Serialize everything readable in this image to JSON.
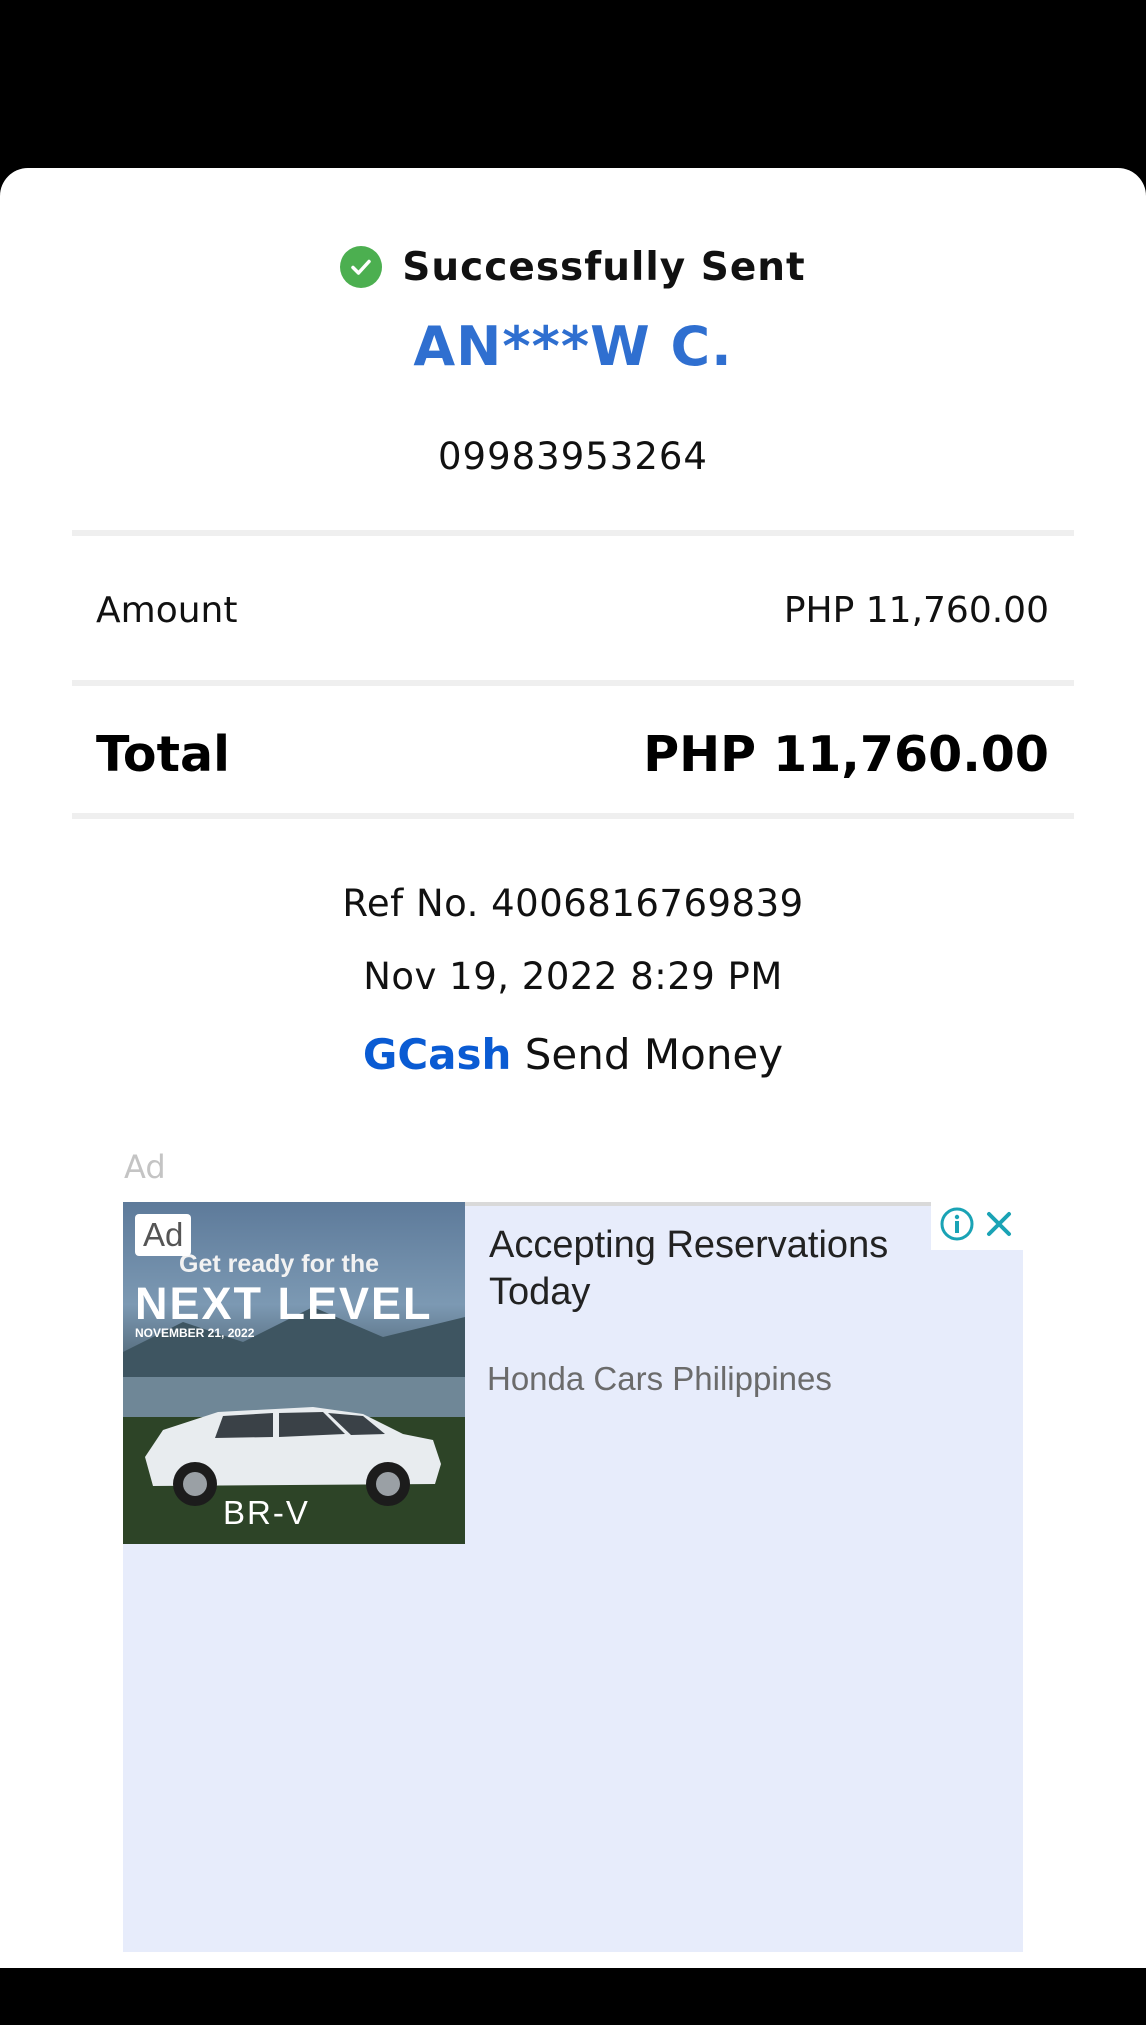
{
  "receipt": {
    "status": "Successfully Sent",
    "recipient_name": "AN***W C.",
    "recipient_number": "09983953264",
    "amount_label": "Amount",
    "amount_value": "PHP 11,760.00",
    "total_label": "Total",
    "total_value": "PHP 11,760.00",
    "ref_no": "Ref No. 4006816769839",
    "datetime": "Nov 19, 2022 8:29 PM",
    "service_brand": "GCash",
    "service_name": "Send Money"
  },
  "ad": {
    "section_label": "Ad",
    "badge": "Ad",
    "image_text_top": "Get ready for the",
    "image_text_main": "NEXT LEVEL",
    "image_text_date": "NOVEMBER 21, 2022",
    "image_text_model": "BR-V",
    "headline": "Accepting Reservations Today",
    "advertiser": "Honda Cars Philippines"
  },
  "colors": {
    "accent_blue": "#2f6fd0",
    "gcash_blue": "#0a5bd3",
    "success_green": "#4caf50",
    "ad_background": "#e7ecfb",
    "ad_controls": "#1aa3b5"
  },
  "icons": {
    "status": "check-circle-icon",
    "ad_info": "info-icon",
    "ad_close": "close-icon"
  }
}
